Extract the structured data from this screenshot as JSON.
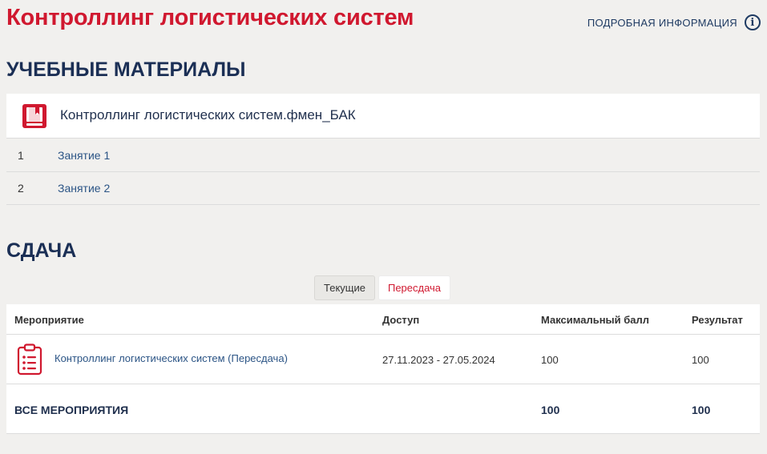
{
  "header": {
    "title": "Контроллинг логистических систем",
    "details_link": "ПОДРОБНАЯ ИНФОРМАЦИЯ",
    "details_icon": "info-icon"
  },
  "materials": {
    "section_title": "УЧЕБНЫЕ МАТЕРИАЛЫ",
    "course": {
      "icon": "book-icon",
      "name": "Контроллинг логистических систем.фмен_БАК"
    },
    "lessons": [
      {
        "num": "1",
        "label": "Занятие 1"
      },
      {
        "num": "2",
        "label": "Занятие 2"
      }
    ]
  },
  "exam": {
    "section_title": "СДАЧА",
    "tabs": [
      {
        "label": "Текущие",
        "active": false
      },
      {
        "label": "Пересдача",
        "active": true
      }
    ],
    "table": {
      "headers": [
        "Мероприятие",
        "Доступ",
        "Максимальный балл",
        "Результат"
      ],
      "rows": [
        {
          "icon": "clipboard-icon",
          "event": "Контроллинг логистических систем (Пересдача)",
          "access": "27.11.2023 - 27.05.2024",
          "max_score": "100",
          "result": "100"
        }
      ],
      "footer": {
        "label": "ВСЕ МЕРОПРИЯТИЯ",
        "max_score": "100",
        "result": "100"
      }
    }
  },
  "colors": {
    "accent_red": "#d0182f",
    "navy": "#1b2f55",
    "link_blue": "#2b5485",
    "background": "#f1f0ee"
  }
}
